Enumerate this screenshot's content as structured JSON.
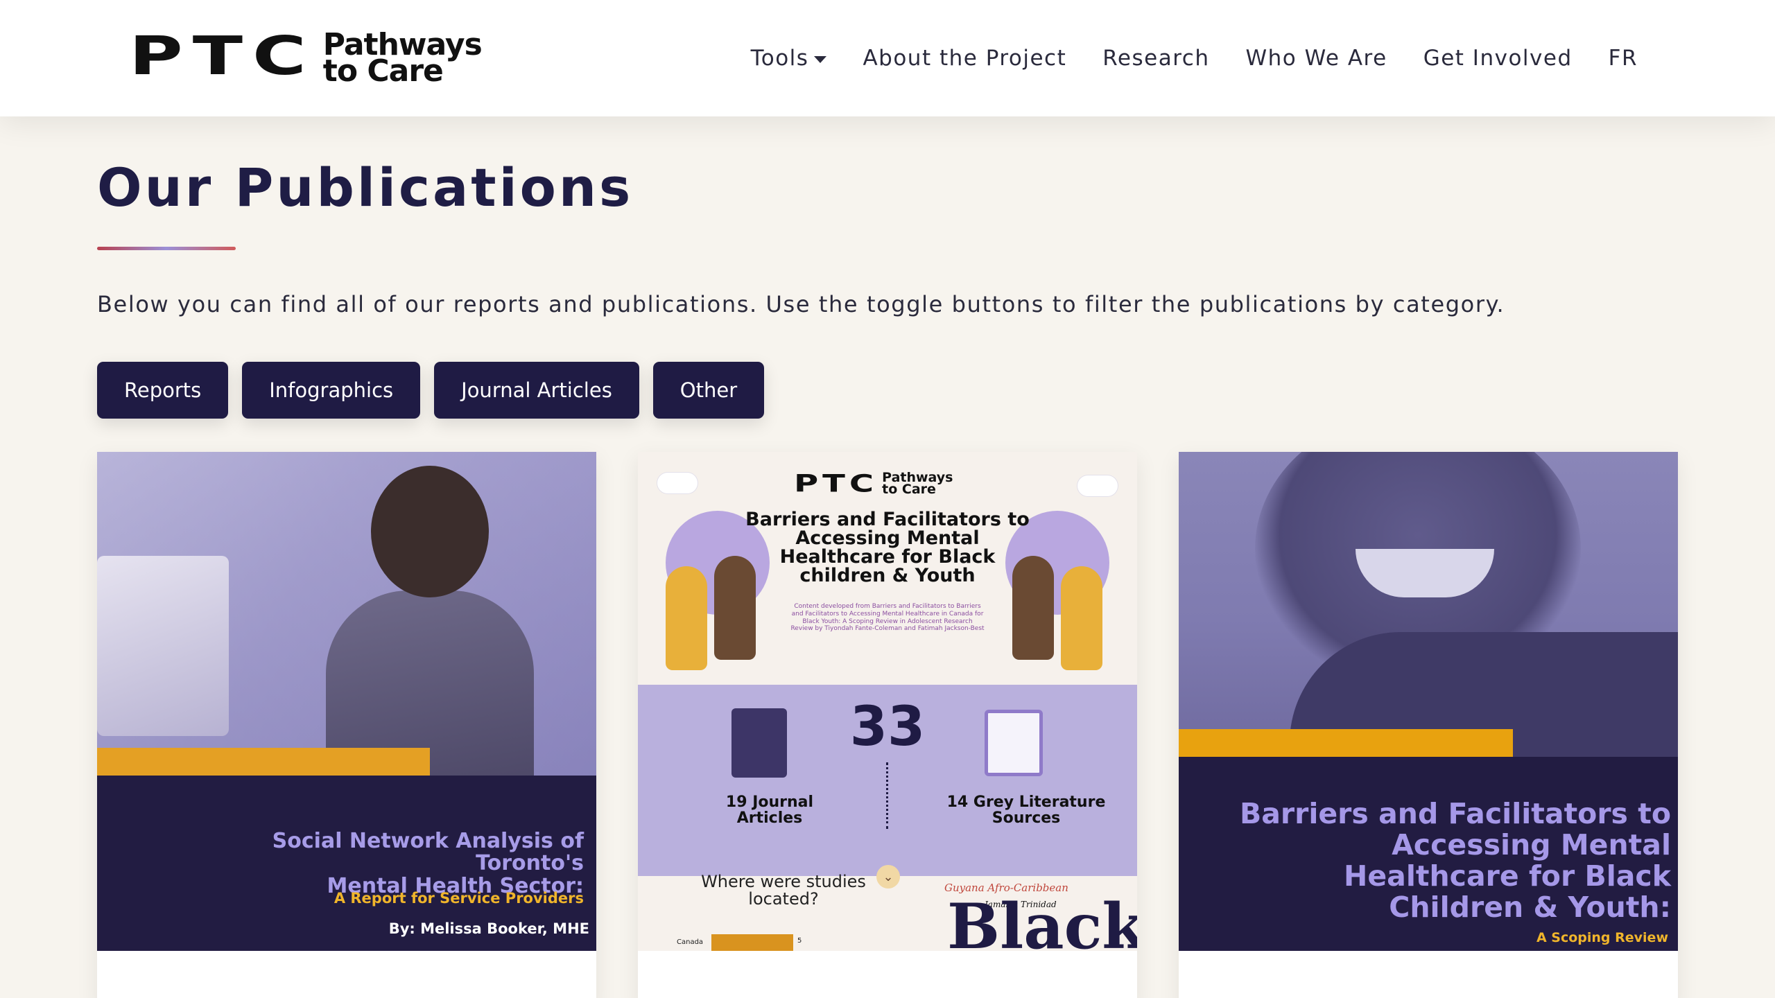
{
  "nav": {
    "logo_ptc": "PTC",
    "logo_line1": "Pathways",
    "logo_line2": "to Care",
    "items": [
      {
        "label": "Tools"
      },
      {
        "label": "About the Project"
      },
      {
        "label": "Research"
      },
      {
        "label": "Who We Are"
      },
      {
        "label": "Get Involved"
      },
      {
        "label": "FR"
      }
    ]
  },
  "page": {
    "title": "Our Publications",
    "intro": "Below you can find all of our reports and publications. Use the toggle buttons to filter the publications by category."
  },
  "filters": [
    "Reports",
    "Infographics",
    "Journal Articles",
    "Other"
  ],
  "cards": [
    {
      "title_line1": "Social Network Analysis of Toronto's",
      "title_line2": "Mental Health Sector:",
      "subtitle": "A Report for Service Providers",
      "byline": "By: Melissa Booker, MHE"
    },
    {
      "logo_ptc": "PTC",
      "logo_line1": "Pathways",
      "logo_line2": "to Care",
      "heading": "Barriers and Facilitators to Accessing Mental Healthcare for Black children & Youth",
      "fine_print": "Content developed from Barriers and Facilitators to Barriers and Facilitators to Accessing Mental Healthcare in Canada for Black Youth: A Scoping Review in Adolescent Research Review by Tiyondah Fante-Coleman and Fatimah Jackson-Best",
      "stat_total": "33",
      "stat_left": "19 Journal Articles",
      "stat_right": "14 Grey Literature Sources",
      "question": "Where were studies located?",
      "bar_label": "Canada",
      "bar_value": "5",
      "word_main": "Black",
      "word_small1": "Guyana Afro-Caribbean",
      "word_small2": "Jamaica Trinidad"
    },
    {
      "title": "Barriers and Facilitators to Accessing Mental Healthcare for Black Children & Youth:",
      "subtitle": "A Scoping Review"
    }
  ]
}
